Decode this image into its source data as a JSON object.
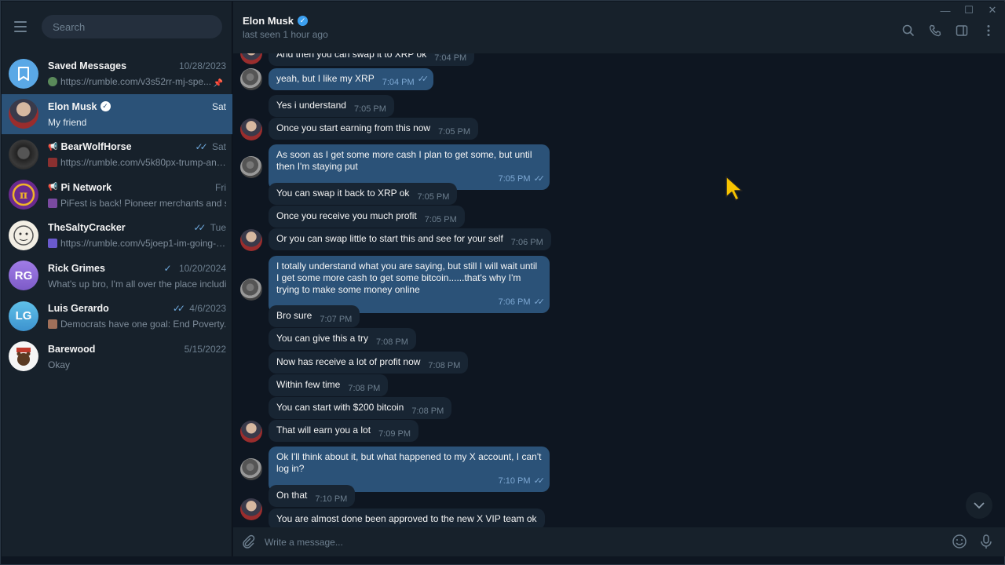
{
  "window": {
    "minimize": "—",
    "maximize": "☐",
    "close": "✕"
  },
  "search": {
    "placeholder": "Search"
  },
  "chats": [
    {
      "name": "Saved Messages",
      "date": "10/28/2023",
      "preview": "https://rumble.com/v3s52rr-mj-spe...",
      "avatar_color": "#5aa8e6",
      "avatar_text": "",
      "pinned": true
    },
    {
      "name": "Elon Musk",
      "date": "Sat",
      "preview": "My friend",
      "verified": true,
      "active": true
    },
    {
      "name": "BearWolfHorse",
      "date": "Sat",
      "preview": "https://rumble.com/v5k80px-trump-and...",
      "channel": true
    },
    {
      "name": "Pi Network",
      "date": "Fri",
      "preview": "PiFest is back! Pioneer merchants and s...",
      "channel": true
    },
    {
      "name": "TheSaltyCracker",
      "date": "Tue",
      "preview": "https://rumble.com/v5joep1-im-going-t..."
    },
    {
      "name": "Rick Grimes",
      "date": "10/20/2024",
      "preview": "What's up bro, I'm all over the place includi...",
      "avatar_text": "RG",
      "avatar_color": "#8f6dd6"
    },
    {
      "name": "Luis Gerardo",
      "date": "4/6/2023",
      "preview": "Democrats have one goal: End Poverty.....",
      "avatar_text": "LG",
      "avatar_color": "#4fa7d9"
    },
    {
      "name": "Barewood",
      "date": "5/15/2022",
      "preview": "Okay"
    }
  ],
  "header": {
    "name": "Elon Musk",
    "status": "last seen 1 hour ago"
  },
  "messages": [
    {
      "dir": "in",
      "text": "And then you can swap it to XRP ok",
      "time": "7:04 PM"
    },
    {
      "dir": "out",
      "text": "yeah, but I like my XRP",
      "time": "7:04 PM"
    },
    {
      "dir": "in",
      "text": "Yes i understand",
      "time": "7:05 PM"
    },
    {
      "dir": "in",
      "text": "Once you start earning from this now",
      "time": "7:05 PM"
    },
    {
      "dir": "out",
      "text": "As soon as I get some more cash I plan to get some, but until then I'm staying put",
      "time": "7:05 PM"
    },
    {
      "dir": "in",
      "text": "You can swap it back to XRP ok",
      "time": "7:05 PM"
    },
    {
      "dir": "in",
      "text": "Once you receive you much profit",
      "time": "7:05 PM"
    },
    {
      "dir": "in",
      "text": "Or you can swap little to start this and see for your self",
      "time": "7:06 PM"
    },
    {
      "dir": "out",
      "text": "I totally understand what you are saying, but still I will wait until I get some more cash to get some bitcoin......that's why I'm trying to make some money online",
      "time": "7:06 PM"
    },
    {
      "dir": "in",
      "text": "Bro sure",
      "time": "7:07 PM"
    },
    {
      "dir": "in",
      "text": "You can give this a try",
      "time": "7:08 PM"
    },
    {
      "dir": "in",
      "text": "Now has receive a lot of profit now",
      "time": "7:08 PM"
    },
    {
      "dir": "in",
      "text": "Within few time",
      "time": "7:08 PM"
    },
    {
      "dir": "in",
      "text": "You can start with $200 bitcoin",
      "time": "7:08 PM"
    },
    {
      "dir": "in",
      "text": "That will earn you a lot",
      "time": "7:09 PM"
    },
    {
      "dir": "out",
      "text": "Ok I'll think about it, but what happened to my X account, I can't log in?",
      "time": "7:10 PM"
    },
    {
      "dir": "in",
      "text": "On that",
      "time": "7:10 PM"
    },
    {
      "dir": "in",
      "text": "You are almost done been approved to the new X VIP team ok",
      "time": ""
    }
  ],
  "composer": {
    "placeholder": "Write a message..."
  }
}
